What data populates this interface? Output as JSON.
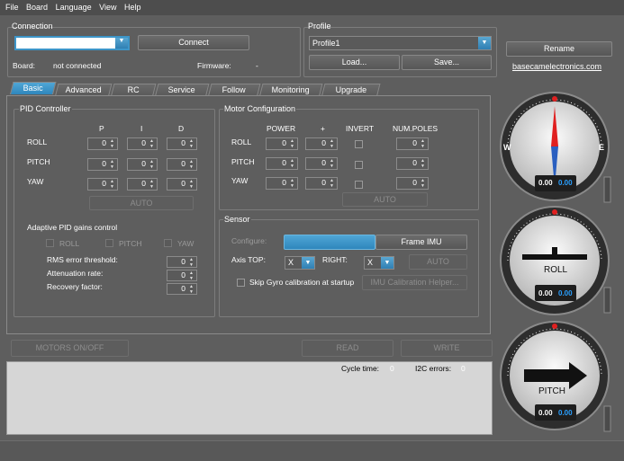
{
  "menu": [
    "File",
    "Board",
    "Language",
    "View",
    "Help"
  ],
  "connection": {
    "title": "Connection",
    "port_value": "",
    "connect_label": "Connect",
    "board_label": "Board:",
    "board_value": "not connected",
    "firmware_label": "Firmware:",
    "firmware_value": "-"
  },
  "profile": {
    "title": "Profile",
    "selected": "Profile1",
    "load_label": "Load...",
    "save_label": "Save...",
    "rename_label": "Rename",
    "link": "basecamelectronics.com"
  },
  "tabs": [
    "Basic",
    "Advanced",
    "RC",
    "Service",
    "Follow",
    "Monitoring",
    "Upgrade"
  ],
  "pid": {
    "title": "PID Controller",
    "cols": [
      "P",
      "I",
      "D"
    ],
    "rows": [
      {
        "label": "ROLL",
        "values": [
          "0",
          "0",
          "0"
        ]
      },
      {
        "label": "PITCH",
        "values": [
          "0",
          "0",
          "0"
        ]
      },
      {
        "label": "YAW",
        "values": [
          "0",
          "0",
          "0"
        ]
      }
    ],
    "auto_label": "AUTO"
  },
  "motor": {
    "title": "Motor Configuration",
    "cols": [
      "POWER",
      "+",
      "INVERT",
      "NUM.POLES"
    ],
    "rows": [
      {
        "label": "ROLL",
        "power": "0",
        "plus": "0",
        "poles": "0"
      },
      {
        "label": "PITCH",
        "power": "0",
        "plus": "0",
        "poles": "0"
      },
      {
        "label": "YAW",
        "power": "0",
        "plus": "0",
        "poles": "0"
      }
    ],
    "auto_label": "AUTO"
  },
  "adaptive": {
    "title": "Adaptive PID gains control",
    "checks": [
      "ROLL",
      "PITCH",
      "YAW"
    ],
    "fields": [
      {
        "label": "RMS error threshold:",
        "value": "0"
      },
      {
        "label": "Attenuation rate:",
        "value": "0"
      },
      {
        "label": "Recovery factor:",
        "value": "0"
      }
    ]
  },
  "sensor": {
    "title": "Sensor",
    "configure_label": "Configure:",
    "frame_imu_label": "Frame IMU",
    "axis_top_label": "Axis TOP:",
    "axis_top_value": "X",
    "right_label": "RIGHT:",
    "right_value": "X",
    "auto_label": "AUTO",
    "skip_gyro_label": "Skip Gyro calibration at startup",
    "imu_helper_label": "IMU Calibration Helper..."
  },
  "bottom": {
    "motors_label": "MOTORS ON/OFF",
    "read_label": "READ",
    "write_label": "WRITE",
    "cycle_time_label": "Cycle time:",
    "cycle_time_value": "0",
    "i2c_label": "I2C errors:",
    "i2c_value": "0"
  },
  "gauges": [
    {
      "name": "yaw",
      "label": "",
      "west": "W",
      "east": "E",
      "value1": "0.00",
      "value2": "0.00"
    },
    {
      "name": "roll",
      "label": "ROLL",
      "value1": "0.00",
      "value2": "0.00"
    },
    {
      "name": "pitch",
      "label": "PITCH",
      "value1": "0.00",
      "value2": "0.00"
    }
  ],
  "colors": {
    "accent": "#3d95c8",
    "value_blue": "#2aa0ff",
    "marker_red": "#e02020"
  }
}
